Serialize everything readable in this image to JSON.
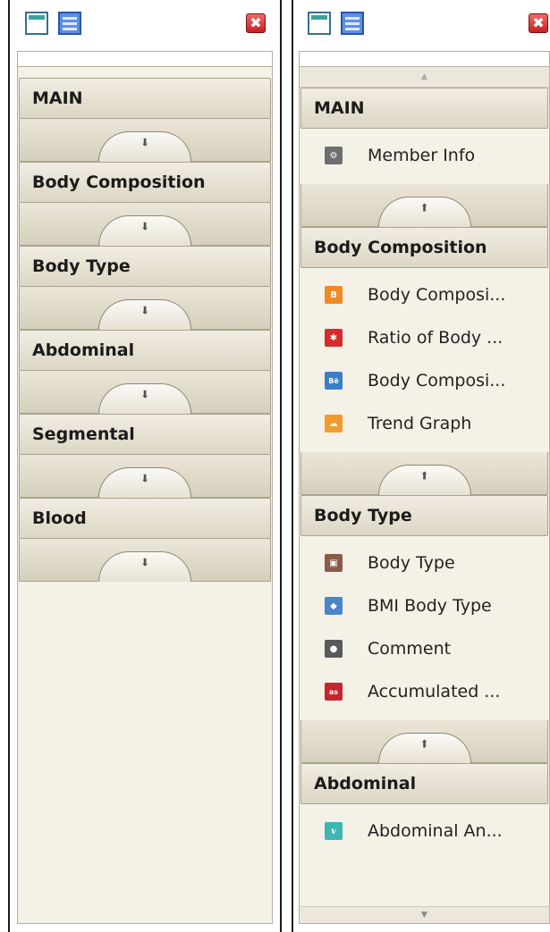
{
  "close_glyph": "✖",
  "scroll_up_glyph": "▲",
  "scroll_down_glyph": "▼",
  "collapse_glyph": "⬇",
  "expand_glyph": "⬆",
  "left_panel": {
    "sections": [
      "MAIN",
      "Body Composition",
      "Body Type",
      "Abdominal",
      "Segmental",
      "Blood"
    ]
  },
  "right_panel": {
    "main": {
      "title": "MAIN",
      "items": [
        {
          "label": "Member Info",
          "icon": "member-info-icon",
          "color": "#6e6e6e"
        }
      ]
    },
    "body_composition": {
      "title": "Body Composition",
      "items": [
        {
          "label": "Body Composi...",
          "icon": "blogger-icon",
          "color": "#f08a24"
        },
        {
          "label": "Ratio of Body ...",
          "icon": "yelp-icon",
          "color": "#d52b2b"
        },
        {
          "label": "Body Composi...",
          "icon": "behance-icon",
          "color": "#3b7fc4"
        },
        {
          "label": "Trend Graph",
          "icon": "cloud-icon",
          "color": "#f39a2d"
        }
      ]
    },
    "body_type": {
      "title": "Body Type",
      "items": [
        {
          "label": "Body Type",
          "icon": "body-type-icon",
          "color": "#8b5a4a"
        },
        {
          "label": "BMI Body Type",
          "icon": "bmi-icon",
          "color": "#4a86c8"
        },
        {
          "label": "Comment",
          "icon": "evernote-icon",
          "color": "#5a5a5a"
        },
        {
          "label": "Accumulated ...",
          "icon": "lastfm-icon",
          "color": "#c4262e"
        }
      ]
    },
    "abdominal": {
      "title": "Abdominal",
      "items": [
        {
          "label": "Abdominal An...",
          "icon": "vimeo-icon",
          "color": "#3fb6b2"
        }
      ]
    }
  }
}
